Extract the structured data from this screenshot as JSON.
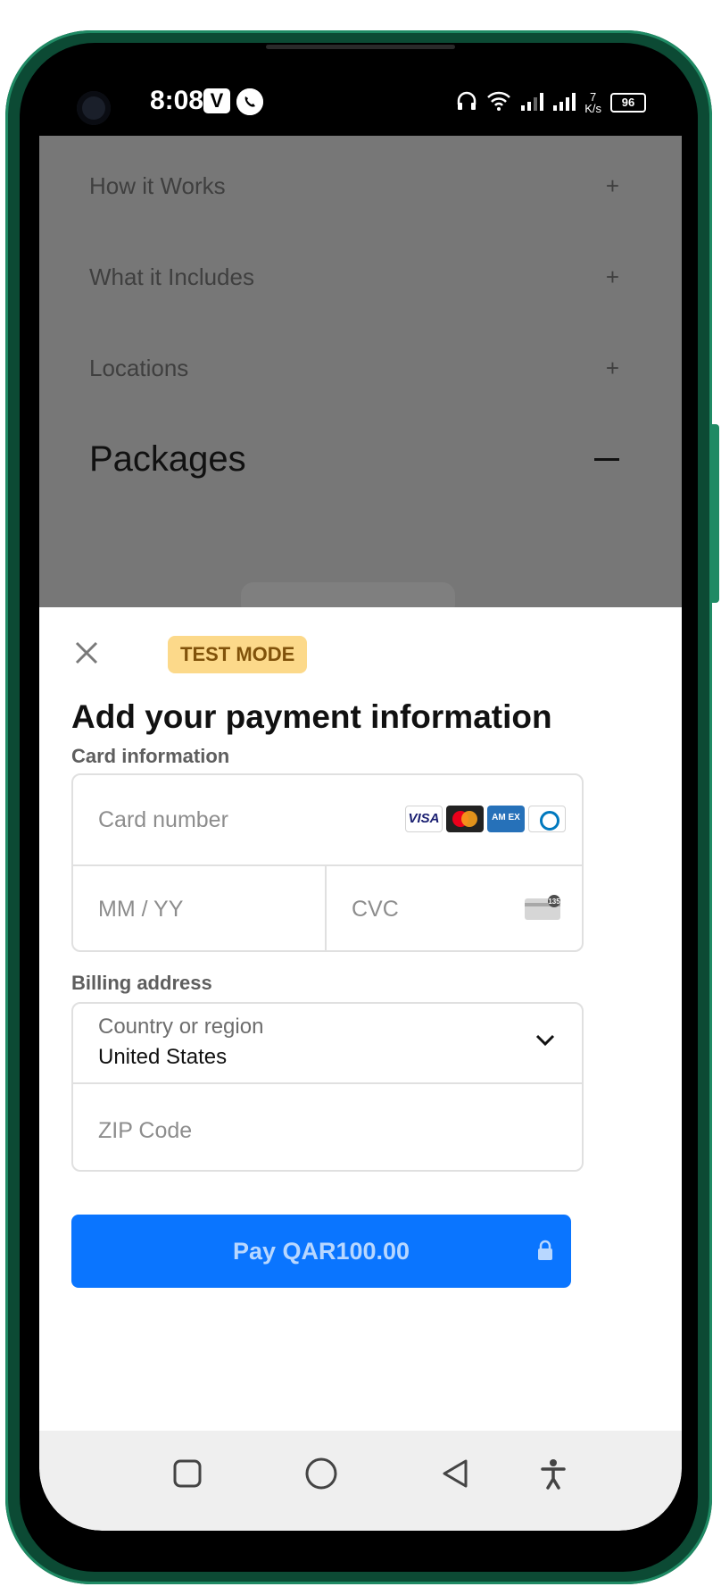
{
  "status_bar": {
    "time": "8:08",
    "v_badge": "V",
    "battery": "96",
    "net_speed_value": "7",
    "net_speed_unit": "K/s",
    "icons": [
      "headphones-icon",
      "wifi-icon",
      "signal-icon",
      "signal-icon"
    ]
  },
  "background_page": {
    "accordion": [
      {
        "label": "How it Works",
        "symbol": "+"
      },
      {
        "label": "What it Includes",
        "symbol": "+"
      },
      {
        "label": "Locations",
        "symbol": "+"
      }
    ],
    "packages_title": "Packages"
  },
  "payment_sheet": {
    "test_mode_label": "TEST MODE",
    "title": "Add your payment information",
    "card_info_label": "Card information",
    "card_number_placeholder": "Card number",
    "brands": [
      "VISA",
      "Mastercard",
      "American Express",
      "Diners Club"
    ],
    "visa_label": "VISA",
    "amex_label": "AM EX",
    "expiry_placeholder": "MM / YY",
    "cvc_placeholder": "CVC",
    "cvc_icon_badge": "135",
    "billing_label": "Billing address",
    "country_label": "Country or region",
    "country_value": "United States",
    "zip_placeholder": "ZIP Code",
    "pay_button_label": "Pay QAR100.00"
  },
  "colors": {
    "accent": "#0a75ff",
    "test_badge_bg": "#fcd98a",
    "test_badge_text": "#80520a",
    "phone_frame": "#0c4a34"
  },
  "nav_bar": {
    "icons": [
      "recent-apps-icon",
      "home-icon",
      "back-icon",
      "accessibility-icon"
    ]
  }
}
